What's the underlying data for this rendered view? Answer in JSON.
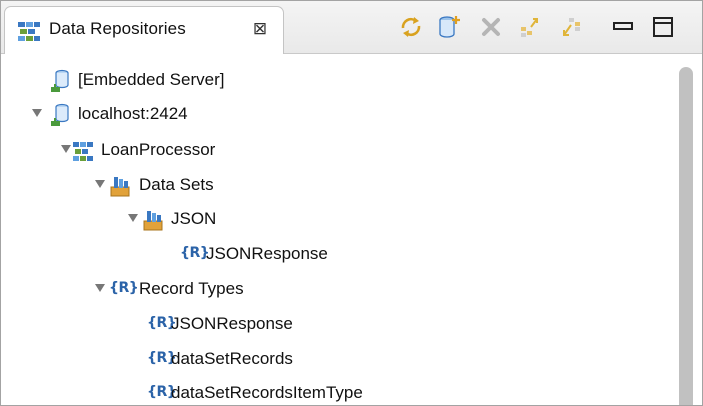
{
  "view": {
    "title": "Data Repositories",
    "close_glyph": "⊠",
    "tab_icon": "repository-view-icon"
  },
  "toolbar": {
    "buttons": [
      {
        "icon": "refresh-icon",
        "color": "#d9a21f"
      },
      {
        "icon": "new-repository-icon",
        "color": "#3a78c2"
      },
      {
        "icon": "delete-icon",
        "color": "#b5b5b5"
      },
      {
        "icon": "expand-all-icon",
        "color": "#e0b53a"
      },
      {
        "icon": "collapse-all-icon",
        "color": "#e0b53a"
      },
      {
        "icon": "minimize-icon",
        "color": "#222222"
      },
      {
        "icon": "maximize-icon",
        "color": "#222222"
      }
    ]
  },
  "tree": {
    "rows": [
      {
        "label": "[Embedded Server]",
        "icon": "database-icon",
        "expanded": false
      },
      {
        "label": "localhost:2424",
        "icon": "database-icon",
        "expanded": true
      },
      {
        "label": "LoanProcessor",
        "icon": "repository-icon",
        "expanded": true
      },
      {
        "label": "Data Sets",
        "icon": "data-set-folder-icon",
        "expanded": true
      },
      {
        "label": "JSON",
        "icon": "data-set-icon",
        "expanded": true
      },
      {
        "label": "JSONResponse",
        "icon": "record-icon",
        "expanded": false
      },
      {
        "label": "Record Types",
        "icon": "record-icon",
        "expanded": true
      },
      {
        "label": "JSONResponse",
        "icon": "record-icon",
        "expanded": false
      },
      {
        "label": "dataSetRecords",
        "icon": "record-icon",
        "expanded": false
      },
      {
        "label": "dataSetRecordsItemType",
        "icon": "record-icon",
        "expanded": false
      }
    ],
    "record_glyph": "{R}"
  },
  "colors": {
    "accent": "#2b63a8",
    "database": "#3a78c2",
    "server_base": "#4a9a3c",
    "folder": "#e1a23a"
  }
}
